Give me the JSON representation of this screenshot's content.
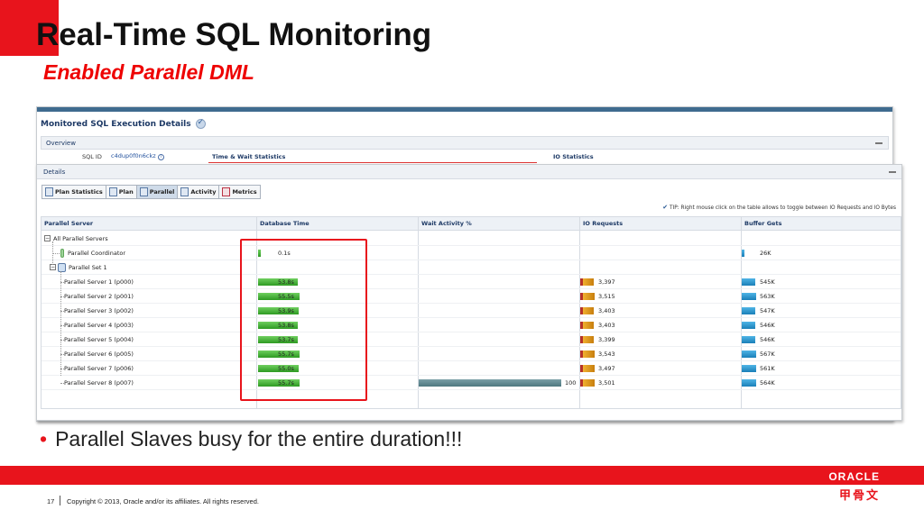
{
  "slide": {
    "title": "Real-Time SQL Monitoring",
    "subtitle": "Enabled Parallel DML",
    "bullet": "Parallel Slaves busy for the entire duration!!!",
    "page_number": "17",
    "copyright": "Copyright © 2013, Oracle and/or its affiliates. All rights reserved.",
    "logo_text": "ORACLE",
    "logo_cn": "甲骨文"
  },
  "monitor": {
    "title": "Monitored SQL Execution Details",
    "overview_label": "Overview",
    "sql_id_label": "SQL ID",
    "sql_id_value": "c4dup0f0n6ckz",
    "time_wait_label": "Time & Wait Statistics",
    "io_stats_label": "IO Statistics",
    "details_label": "Details",
    "tip": "TIP: Right mouse click on the table allows to toggle between IO Requests and IO Bytes",
    "tabs": [
      {
        "label": "Plan Statistics"
      },
      {
        "label": "Plan"
      },
      {
        "label": "Parallel"
      },
      {
        "label": "Activity"
      },
      {
        "label": "Metrics"
      }
    ],
    "columns": {
      "server": "Parallel Server",
      "db_time": "Database Time",
      "wait": "Wait Activity %",
      "io": "IO Requests",
      "buffer": "Buffer Gets"
    },
    "rows": [
      {
        "name": "All Parallel Servers",
        "db_time": "",
        "db_frac": 0,
        "wait": "",
        "wait_frac": 0,
        "io": "",
        "io_frac": 0,
        "buffer": "",
        "buf_frac": 0
      },
      {
        "name": "Parallel Coordinator",
        "db_time": "0.1s",
        "db_frac": 0.01,
        "wait": "",
        "wait_frac": 0,
        "io": "",
        "io_frac": 0,
        "buffer": "26K",
        "buf_frac": 0.05
      },
      {
        "name": "Parallel Set 1",
        "db_time": "",
        "db_frac": 0,
        "wait": "",
        "wait_frac": 0,
        "io": "",
        "io_frac": 0,
        "buffer": "",
        "buf_frac": 0
      },
      {
        "name": "Parallel Server 1 (p000)",
        "db_time": "53.8s",
        "db_frac": 0.966,
        "wait": "",
        "wait_frac": 0,
        "io": "3,397",
        "io_frac": 0.959,
        "buffer": "545K",
        "buf_frac": 0.961
      },
      {
        "name": "Parallel Server 2 (p001)",
        "db_time": "55.5s",
        "db_frac": 0.996,
        "wait": "",
        "wait_frac": 0,
        "io": "3,515",
        "io_frac": 0.992,
        "buffer": "563K",
        "buf_frac": 0.993
      },
      {
        "name": "Parallel Server 3 (p002)",
        "db_time": "53.9s",
        "db_frac": 0.968,
        "wait": "",
        "wait_frac": 0,
        "io": "3,403",
        "io_frac": 0.96,
        "buffer": "547K",
        "buf_frac": 0.965
      },
      {
        "name": "Parallel Server 4 (p003)",
        "db_time": "53.8s",
        "db_frac": 0.966,
        "wait": "",
        "wait_frac": 0,
        "io": "3,403",
        "io_frac": 0.96,
        "buffer": "546K",
        "buf_frac": 0.963
      },
      {
        "name": "Parallel Server 5 (p004)",
        "db_time": "53.7s",
        "db_frac": 0.964,
        "wait": "",
        "wait_frac": 0,
        "io": "3,399",
        "io_frac": 0.959,
        "buffer": "546K",
        "buf_frac": 0.963
      },
      {
        "name": "Parallel Server 6 (p005)",
        "db_time": "55.7s",
        "db_frac": 1.0,
        "wait": "",
        "wait_frac": 0,
        "io": "3,543",
        "io_frac": 1.0,
        "buffer": "567K",
        "buf_frac": 1.0
      },
      {
        "name": "Parallel Server 7 (p006)",
        "db_time": "55.0s",
        "db_frac": 0.987,
        "wait": "",
        "wait_frac": 0,
        "io": "3,497",
        "io_frac": 0.987,
        "buffer": "561K",
        "buf_frac": 0.989
      },
      {
        "name": "Parallel Server 8 (p007)",
        "db_time": "55.7s",
        "db_frac": 1.0,
        "wait": "100",
        "wait_frac": 1.0,
        "io": "3,501",
        "io_frac": 0.988,
        "buffer": "564K",
        "buf_frac": 0.995
      }
    ]
  }
}
